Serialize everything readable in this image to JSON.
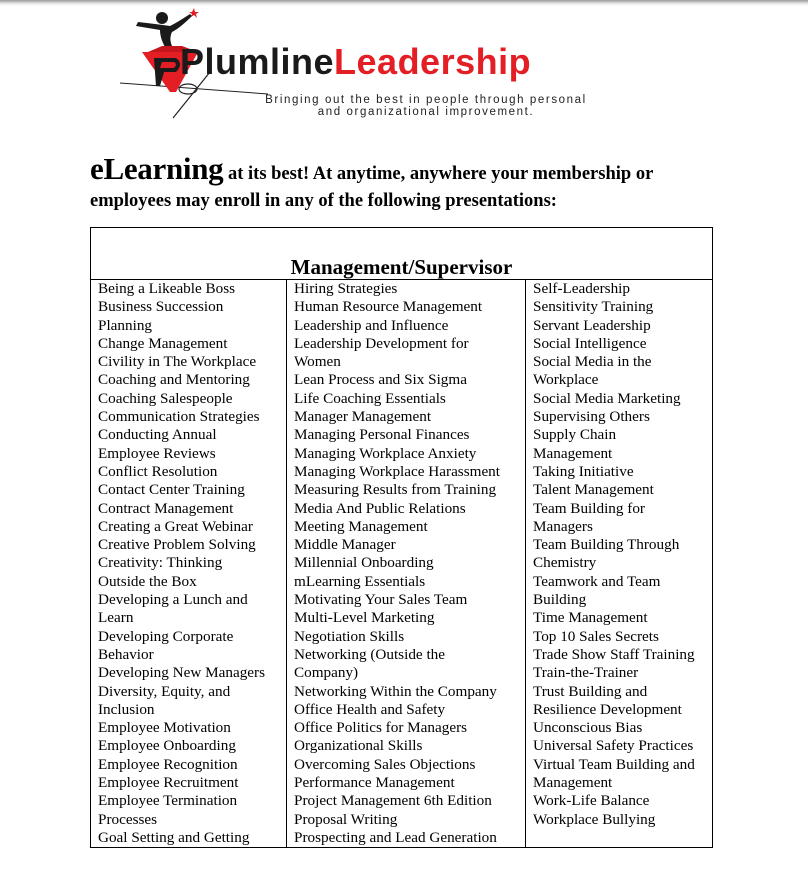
{
  "logo": {
    "name_part1": "Plumline",
    "name_part2": "Leadership",
    "tagline_line1": "Bringing out the best in people through personal",
    "tagline_line2": "and organizational improvement.",
    "icon": "tightrope-walker-plumb-bob-icon",
    "colors": {
      "red": "#e31e24",
      "dark": "#1a1a1a"
    }
  },
  "intro": {
    "big_word": "eLearning",
    "rest_line1": " at its best! At anytime, anywhere your membership or",
    "line2": "employees may enroll in any of the following presentations:"
  },
  "table": {
    "title": "Management/Supervisor",
    "columns": [
      [
        "Being a Likeable Boss",
        "Business Succession",
        "Planning",
        "Change Management",
        "Civility in The Workplace",
        "Coaching and Mentoring",
        "Coaching Salespeople",
        "Communication Strategies",
        "Conducting Annual",
        "Employee Reviews",
        "Conflict Resolution",
        "Contact Center Training",
        "Contract Management",
        "Creating a Great Webinar",
        "Creative Problem Solving",
        "Creativity: Thinking",
        "Outside the Box",
        "Developing a Lunch and",
        "Learn",
        "Developing Corporate",
        "Behavior",
        "Developing New Managers",
        "Diversity, Equity, and",
        "Inclusion",
        "Employee Motivation",
        "Employee Onboarding",
        "Employee Recognition",
        "Employee Recruitment",
        "Employee Termination",
        "Processes",
        "Goal Setting and Getting"
      ],
      [
        "Hiring Strategies",
        "Human Resource Management",
        "Leadership and Influence",
        "Leadership Development for",
        "Women",
        "Lean Process and Six Sigma",
        "Life Coaching Essentials",
        "Manager Management",
        "Managing Personal Finances",
        "Managing Workplace Anxiety",
        "Managing Workplace Harassment",
        "Measuring Results from Training",
        "Media And Public Relations",
        "Meeting Management",
        "Middle Manager",
        "Millennial Onboarding",
        "mLearning Essentials",
        "Motivating Your Sales Team",
        "Multi-Level Marketing",
        "Negotiation Skills",
        "Networking (Outside the",
        "Company)",
        "Networking Within the Company",
        "Office Health and Safety",
        "Office Politics for Managers",
        "Organizational Skills",
        "Overcoming Sales Objections",
        "Performance Management",
        "Project Management 6th Edition",
        "Proposal Writing",
        "Prospecting and Lead Generation"
      ],
      [
        "Self-Leadership",
        "Sensitivity Training",
        "Servant Leadership",
        "Social Intelligence",
        "Social Media in the",
        "Workplace",
        "Social Media Marketing",
        "Supervising Others",
        "Supply Chain",
        "Management",
        "Taking Initiative",
        "Talent Management",
        "Team Building for",
        "Managers",
        "Team Building Through",
        "Chemistry",
        "Teamwork and Team",
        "Building",
        "Time Management",
        "Top 10 Sales Secrets",
        "Trade Show Staff Training",
        "Train-the-Trainer",
        "Trust Building and",
        "Resilience Development",
        "Unconscious Bias",
        "Universal Safety Practices",
        "Virtual Team Building and",
        "Management",
        "Work-Life Balance",
        "Workplace Bullying"
      ]
    ]
  }
}
